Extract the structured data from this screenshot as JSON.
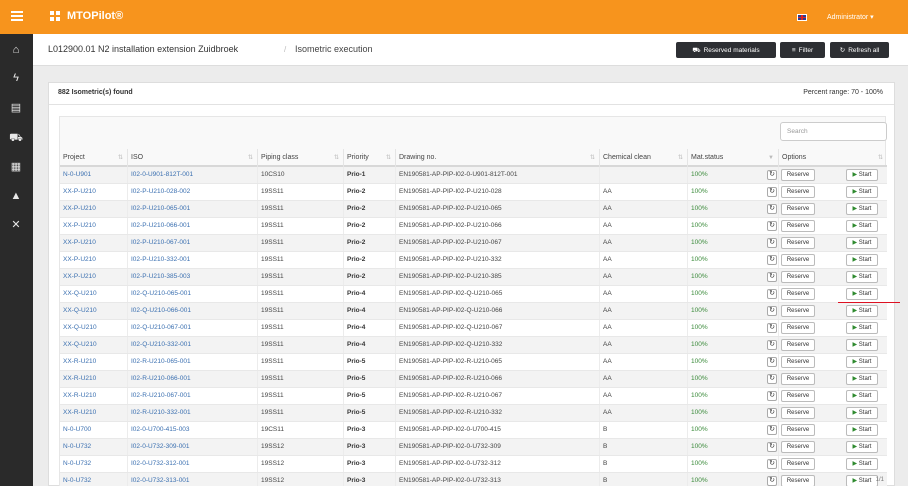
{
  "app": {
    "title": "MTOPilot®",
    "user": "Administrator ▾"
  },
  "sidebar": {
    "icons": [
      "home-icon",
      "flash-icon",
      "book-icon",
      "cart-icon",
      "report-icon",
      "road-icon",
      "tools-icon"
    ]
  },
  "breadcrumb": {
    "project": "L012900.01 N2 installation extension Zuidbroek",
    "page": "Isometric execution"
  },
  "toolbar": {
    "reserved": "Reserved materials",
    "filter": "Filter",
    "refresh_all": "Refresh all"
  },
  "summary": {
    "found": "882 Isometric(s) found",
    "range": "Percent range: 70 - 100%"
  },
  "search": {
    "placeholder": "Search"
  },
  "columns": [
    "Project",
    "ISO",
    "Piping class",
    "Priority",
    "Drawing no.",
    "Chemical clean",
    "Mat.status",
    "Options"
  ],
  "action_labels": {
    "reserve": "Reserve",
    "start": "Start"
  },
  "rows": [
    {
      "project": "N-0-U901",
      "iso": "I02-0-U901-812T-001",
      "piping": "10CS10",
      "priority": "Prio-1",
      "drawing": "EN190581-AP-PIP-I02-0-U901-812T-001",
      "clean": "",
      "status": "100%"
    },
    {
      "project": "XX-P-U210",
      "iso": "I02-P-U210-028-002",
      "piping": "19SS11",
      "priority": "Prio-2",
      "drawing": "EN190581-AP-PIP-I02-P-U210-028",
      "clean": "AA",
      "status": "100%"
    },
    {
      "project": "XX-P-U210",
      "iso": "I02-P-U210-065-001",
      "piping": "19SS11",
      "priority": "Prio-2",
      "drawing": "EN190581-AP-PIP-I02-P-U210-065",
      "clean": "AA",
      "status": "100%"
    },
    {
      "project": "XX-P-U210",
      "iso": "I02-P-U210-066-001",
      "piping": "19SS11",
      "priority": "Prio-2",
      "drawing": "EN190581-AP-PIP-I02-P-U210-066",
      "clean": "AA",
      "status": "100%"
    },
    {
      "project": "XX-P-U210",
      "iso": "I02-P-U210-067-001",
      "piping": "19SS11",
      "priority": "Prio-2",
      "drawing": "EN190581-AP-PIP-I02-P-U210-067",
      "clean": "AA",
      "status": "100%"
    },
    {
      "project": "XX-P-U210",
      "iso": "I02-P-U210-332-001",
      "piping": "19SS11",
      "priority": "Prio-2",
      "drawing": "EN190581-AP-PIP-I02-P-U210-332",
      "clean": "AA",
      "status": "100%"
    },
    {
      "project": "XX-P-U210",
      "iso": "I02-P-U210-385-003",
      "piping": "19SS11",
      "priority": "Prio-2",
      "drawing": "EN190581-AP-PIP-I02-P-U210-385",
      "clean": "AA",
      "status": "100%"
    },
    {
      "project": "XX-Q-U210",
      "iso": "I02-Q-U210-065-001",
      "piping": "19SS11",
      "priority": "Prio-4",
      "drawing": "EN190581-AP-PIP-I02-Q-U210-065",
      "clean": "AA",
      "status": "100%"
    },
    {
      "project": "XX-Q-U210",
      "iso": "I02-Q-U210-066-001",
      "piping": "19SS11",
      "priority": "Prio-4",
      "drawing": "EN190581-AP-PIP-I02-Q-U210-066",
      "clean": "AA",
      "status": "100%"
    },
    {
      "project": "XX-Q-U210",
      "iso": "I02-Q-U210-067-001",
      "piping": "19SS11",
      "priority": "Prio-4",
      "drawing": "EN190581-AP-PIP-I02-Q-U210-067",
      "clean": "AA",
      "status": "100%"
    },
    {
      "project": "XX-Q-U210",
      "iso": "I02-Q-U210-332-001",
      "piping": "19SS11",
      "priority": "Prio-4",
      "drawing": "EN190581-AP-PIP-I02-Q-U210-332",
      "clean": "AA",
      "status": "100%"
    },
    {
      "project": "XX-R-U210",
      "iso": "I02-R-U210-065-001",
      "piping": "19SS11",
      "priority": "Prio-5",
      "drawing": "EN190581-AP-PIP-I02-R-U210-065",
      "clean": "AA",
      "status": "100%"
    },
    {
      "project": "XX-R-U210",
      "iso": "I02-R-U210-066-001",
      "piping": "19SS11",
      "priority": "Prio-5",
      "drawing": "EN190581-AP-PIP-I02-R-U210-066",
      "clean": "AA",
      "status": "100%"
    },
    {
      "project": "XX-R-U210",
      "iso": "I02-R-U210-067-001",
      "piping": "19SS11",
      "priority": "Prio-5",
      "drawing": "EN190581-AP-PIP-I02-R-U210-067",
      "clean": "AA",
      "status": "100%"
    },
    {
      "project": "XX-R-U210",
      "iso": "I02-R-U210-332-001",
      "piping": "19SS11",
      "priority": "Prio-5",
      "drawing": "EN190581-AP-PIP-I02-R-U210-332",
      "clean": "AA",
      "status": "100%"
    },
    {
      "project": "N-0-U700",
      "iso": "I02-0-U700-415-003",
      "piping": "19CS11",
      "priority": "Prio-3",
      "drawing": "EN190581-AP-PIP-I02-0-U700-415",
      "clean": "B",
      "status": "100%"
    },
    {
      "project": "N-0-U732",
      "iso": "I02-0-U732-309-001",
      "piping": "19SS12",
      "priority": "Prio-3",
      "drawing": "EN190581-AP-PIP-I02-0-U732-309",
      "clean": "B",
      "status": "100%"
    },
    {
      "project": "N-0-U732",
      "iso": "I02-0-U732-312-001",
      "piping": "19SS12",
      "priority": "Prio-3",
      "drawing": "EN190581-AP-PIP-I02-0-U732-312",
      "clean": "B",
      "status": "100%"
    },
    {
      "project": "N-0-U732",
      "iso": "I02-0-U732-313-001",
      "piping": "19SS12",
      "priority": "Prio-3",
      "drawing": "EN190581-AP-PIP-I02-0-U732-313",
      "clean": "B",
      "status": "100%"
    }
  ],
  "colors": {
    "accent": "#f7941d",
    "sidebar": "#2a2a2a",
    "link": "#3a6fb0",
    "status_green": "#3a8a3a"
  }
}
